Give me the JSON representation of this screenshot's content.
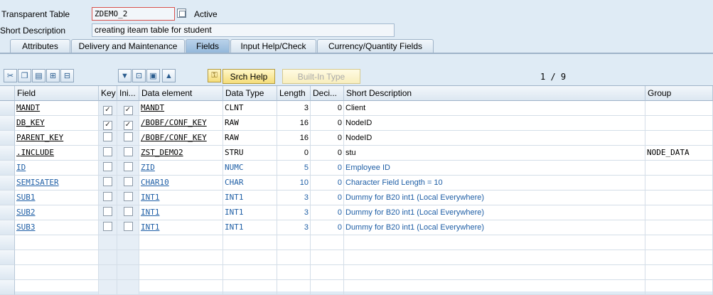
{
  "header": {
    "table_label": "Transparent Table",
    "table_value": "ZDEMO_2",
    "status": "Active",
    "desc_label": "Short Description",
    "desc_value": "creating iteam table for student"
  },
  "tabs": [
    {
      "label": "Attributes",
      "active": false
    },
    {
      "label": "Delivery and Maintenance",
      "active": false
    },
    {
      "label": "Fields",
      "active": true
    },
    {
      "label": "Input Help/Check",
      "active": false
    },
    {
      "label": "Currency/Quantity Fields",
      "active": false
    }
  ],
  "toolbar": {
    "icons": [
      "cut-icon",
      "copy-icon",
      "paste-icon",
      "insert-row-icon",
      "delete-row-icon",
      "move-down-icon",
      "insert-icon",
      "move-block-icon",
      "move-up-icon",
      "search-help-icon"
    ],
    "srch_help": "Srch Help",
    "built_in_type": "Built-In Type",
    "page_indicator": "1 / 9"
  },
  "columns": [
    "Field",
    "Key",
    "Ini...",
    "Data element",
    "Data Type",
    "Length",
    "Deci...",
    "Short Description",
    "Group"
  ],
  "rows": [
    {
      "field": "MANDT",
      "key": true,
      "ini": true,
      "data_element": "MANDT",
      "data_type": "CLNT",
      "length": "3",
      "deci": "0",
      "desc": "Client",
      "group": "",
      "blue": false
    },
    {
      "field": "DB_KEY",
      "key": true,
      "ini": true,
      "data_element": "/BOBF/CONF_KEY",
      "data_type": "RAW",
      "length": "16",
      "deci": "0",
      "desc": "NodeID",
      "group": "",
      "blue": false
    },
    {
      "field": "PARENT_KEY",
      "key": false,
      "ini": false,
      "data_element": "/BOBF/CONF_KEY",
      "data_type": "RAW",
      "length": "16",
      "deci": "0",
      "desc": "NodeID",
      "group": "",
      "blue": false
    },
    {
      "field": ".INCLUDE",
      "key": false,
      "ini": false,
      "data_element": "ZST_DEMO2",
      "data_type": "STRU",
      "length": "0",
      "deci": "0",
      "desc": "stu",
      "group": "NODE_DATA",
      "blue": false
    },
    {
      "field": "ID",
      "key": false,
      "ini": false,
      "data_element": "ZID",
      "data_type": "NUMC",
      "length": "5",
      "deci": "0",
      "desc": "Employee ID",
      "group": "",
      "blue": true
    },
    {
      "field": "SEMISATER",
      "key": false,
      "ini": false,
      "data_element": "CHAR10",
      "data_type": "CHAR",
      "length": "10",
      "deci": "0",
      "desc": "Character Field Length = 10",
      "group": "",
      "blue": true
    },
    {
      "field": "SUB1",
      "key": false,
      "ini": false,
      "data_element": "INT1",
      "data_type": "INT1",
      "length": "3",
      "deci": "0",
      "desc": "Dummy for B20 int1 (Local Everywhere)",
      "group": "",
      "blue": true
    },
    {
      "field": "SUB2",
      "key": false,
      "ini": false,
      "data_element": "INT1",
      "data_type": "INT1",
      "length": "3",
      "deci": "0",
      "desc": "Dummy for B20 int1 (Local Everywhere)",
      "group": "",
      "blue": true
    },
    {
      "field": "SUB3",
      "key": false,
      "ini": false,
      "data_element": "INT1",
      "data_type": "INT1",
      "length": "3",
      "deci": "0",
      "desc": "Dummy for B20 int1 (Local Everywhere)",
      "group": "",
      "blue": true
    }
  ],
  "empty_rows": 4
}
